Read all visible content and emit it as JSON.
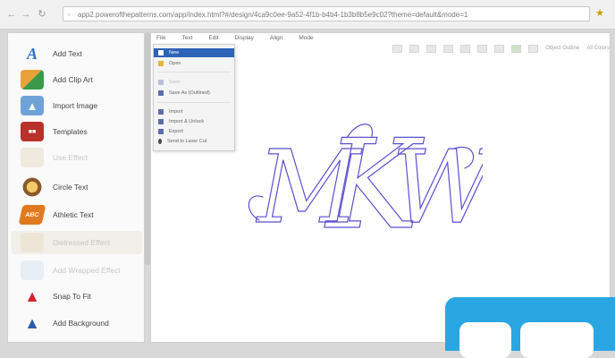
{
  "browser": {
    "url": "app2.powerofthepatterns.com/app/index.html?#/design/4ca9c0ee-9a52-4f1b-b4b4-1b3b8b5e9c02?theme=default&mode=1"
  },
  "sidebar": {
    "items": [
      {
        "label": "Add Text",
        "icon": "add-text-icon",
        "state": "enabled"
      },
      {
        "label": "Add Clip Art",
        "icon": "clip-art-icon",
        "state": "enabled"
      },
      {
        "label": "Import Image",
        "icon": "import-image-icon",
        "state": "enabled"
      },
      {
        "label": "Templates",
        "icon": "templates-icon",
        "state": "enabled"
      },
      {
        "label": "Use Effect",
        "icon": "effect-icon",
        "state": "disabled"
      },
      {
        "label": "Circle Text",
        "icon": "circle-text-icon",
        "state": "enabled"
      },
      {
        "label": "Athletic Text",
        "icon": "athletic-text-icon",
        "state": "enabled"
      },
      {
        "label": "Distressed Effect",
        "icon": "distress-icon",
        "state": "disabled"
      },
      {
        "label": "Add Wrapped Effect",
        "icon": "wrap-icon",
        "state": "disabled"
      },
      {
        "label": "Snap To Fit",
        "icon": "snap-to-fit-icon",
        "state": "enabled"
      },
      {
        "label": "Add Background",
        "icon": "background-icon",
        "state": "enabled"
      }
    ]
  },
  "menubar": {
    "items": [
      "File",
      "Text",
      "Edit",
      "Display",
      "Align",
      "Mode"
    ]
  },
  "toolbar": {
    "labels": [
      "Object Outline",
      "All Colors"
    ]
  },
  "file_menu": {
    "items": [
      {
        "label": "New",
        "state": "selected"
      },
      {
        "label": "Open",
        "state": "normal"
      },
      {
        "label": "Save",
        "state": "disabled"
      },
      {
        "label": "Save As (Outlined)",
        "state": "normal"
      },
      {
        "label": "Import",
        "state": "normal"
      },
      {
        "label": "Import & Unlock",
        "state": "normal"
      },
      {
        "label": "Export",
        "state": "normal"
      },
      {
        "label": "Send to Laser Cut",
        "state": "normal"
      }
    ]
  },
  "canvas": {
    "monogram": "MKW"
  },
  "colors": {
    "accent": "#2c62b8",
    "monogram_stroke": "#5a50d0",
    "logo": "#2aa6e3"
  }
}
